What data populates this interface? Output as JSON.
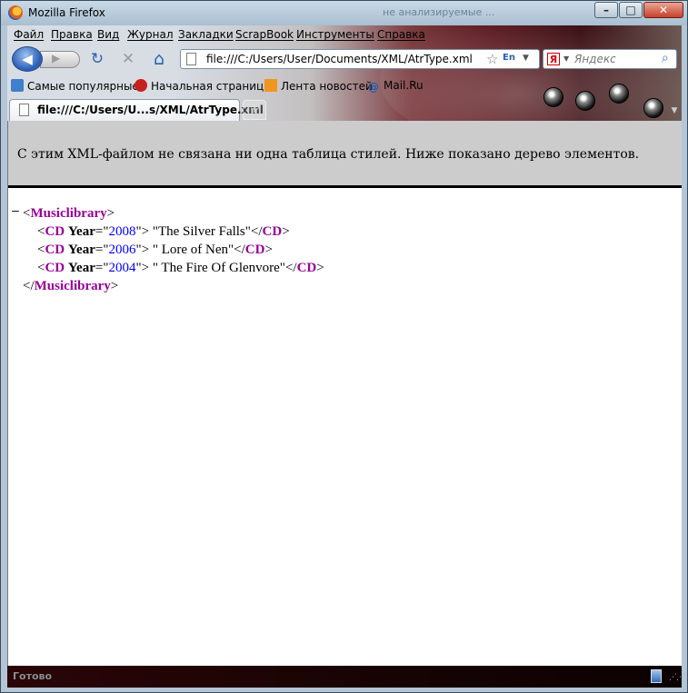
{
  "window": {
    "title": "Mozilla Firefox",
    "ghost_title": "не анализируемые ...",
    "minimize_glyph": "–",
    "maximize_glyph": "□",
    "close_glyph": "✕"
  },
  "menu": {
    "items": [
      "Файл",
      "Правка",
      "Вид",
      "Журнал",
      "Закладки",
      "ScrapBook",
      "Инструменты",
      "Справка"
    ]
  },
  "navbar": {
    "back_glyph": "◀",
    "forward_glyph": "▶",
    "reload_glyph": "↻",
    "stop_glyph": "✕",
    "home_glyph": "⌂",
    "url": "file:///C:/Users/User/Documents/XML/AtrType.xml",
    "lang_badge": "En",
    "search_engine_letter": "Я",
    "search_placeholder": "Яндекс"
  },
  "bookmarks": {
    "items": [
      "Самые популярные",
      "Начальная страница",
      "Лента новостей",
      "Mail.Ru"
    ]
  },
  "tabs": {
    "items": [
      {
        "label": "file:///C:/Users/U...s/XML/AtrType.xml"
      }
    ],
    "new_tab_glyph": "+",
    "all_tabs_glyph": "▼"
  },
  "content": {
    "notice": "С этим XML-файлом не связана ни одна таблица стилей. Ниже показано дерево элементов.",
    "collapse_glyph": "–",
    "root_tag": "Musiclibrary",
    "child_tag": "CD",
    "attr_name": "Year",
    "records": [
      {
        "year": "2008",
        "text": " \"The Silver Falls\""
      },
      {
        "year": "2006",
        "text": " \" Lore of Nen\""
      },
      {
        "year": "2004",
        "text": " \" The Fire Of Glenvore\""
      }
    ]
  },
  "status": {
    "text": "Готово"
  },
  "colors": {
    "tag": "#990099",
    "attr_value": "#0000ff",
    "notice_bg": "#cccccc"
  }
}
